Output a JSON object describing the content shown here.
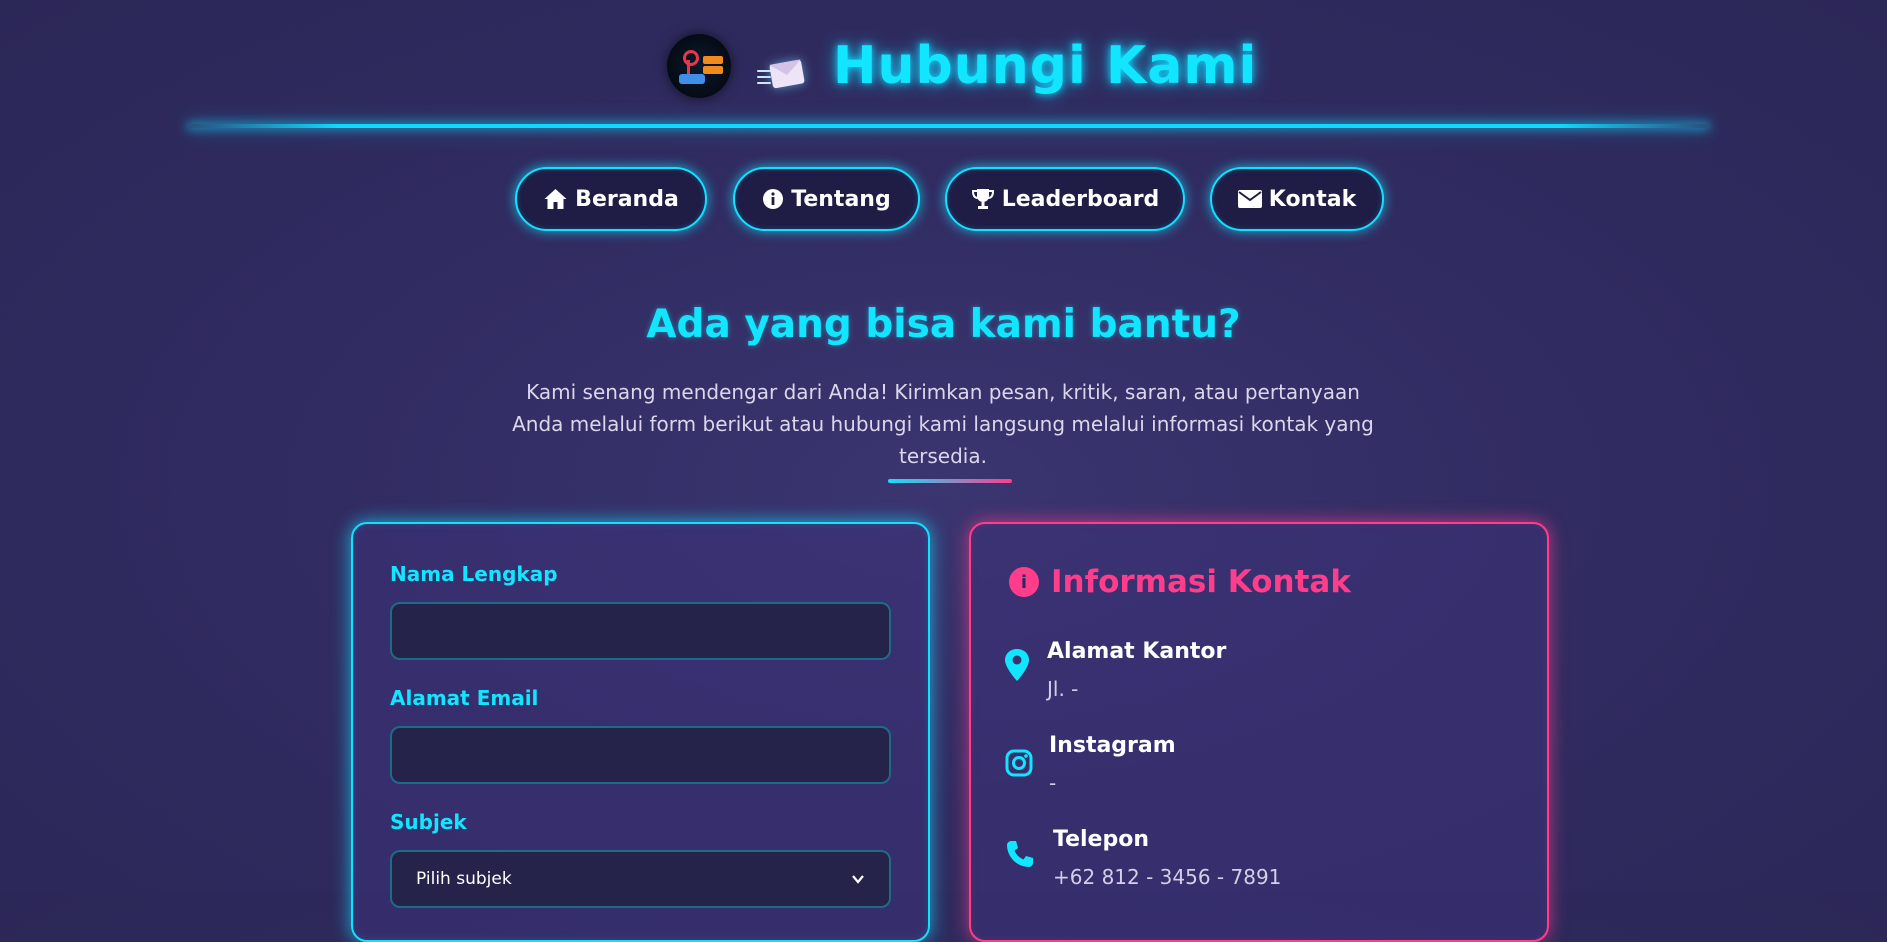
{
  "header": {
    "title": "Hubungi Kami",
    "logo_icon": "arcade-joystick-logo",
    "title_icon": "flying-envelope-icon"
  },
  "nav": [
    {
      "label": "Beranda",
      "icon": "home-icon"
    },
    {
      "label": "Tentang",
      "icon": "info-circle-icon"
    },
    {
      "label": "Leaderboard",
      "icon": "trophy-icon"
    },
    {
      "label": "Kontak",
      "icon": "envelope-icon"
    }
  ],
  "intro": {
    "heading": "Ada yang bisa kami bantu?",
    "text": "Kami senang mendengar dari Anda! Kirimkan pesan, kritik, saran, atau pertanyaan Anda melalui form berikut atau hubungi kami langsung melalui informasi kontak yang tersedia."
  },
  "form": {
    "name_label": "Nama Lengkap",
    "name_value": "",
    "email_label": "Alamat Email",
    "email_value": "",
    "subject_label": "Subjek",
    "subject_selected": "Pilih subjek"
  },
  "contact_info": {
    "title": "Informasi Kontak",
    "items": [
      {
        "heading": "Alamat Kantor",
        "value": "Jl. -",
        "icon": "map-pin-icon"
      },
      {
        "heading": "Instagram",
        "value": "-",
        "icon": "instagram-icon"
      },
      {
        "heading": "Telepon",
        "value": "+62 812 - 3456 - 7891",
        "icon": "phone-icon"
      }
    ]
  },
  "colors": {
    "background": "#302b62",
    "cyan_accent": "#12e6ff",
    "pink_accent": "#ff3d8b",
    "button_bg": "#1f1c46"
  }
}
